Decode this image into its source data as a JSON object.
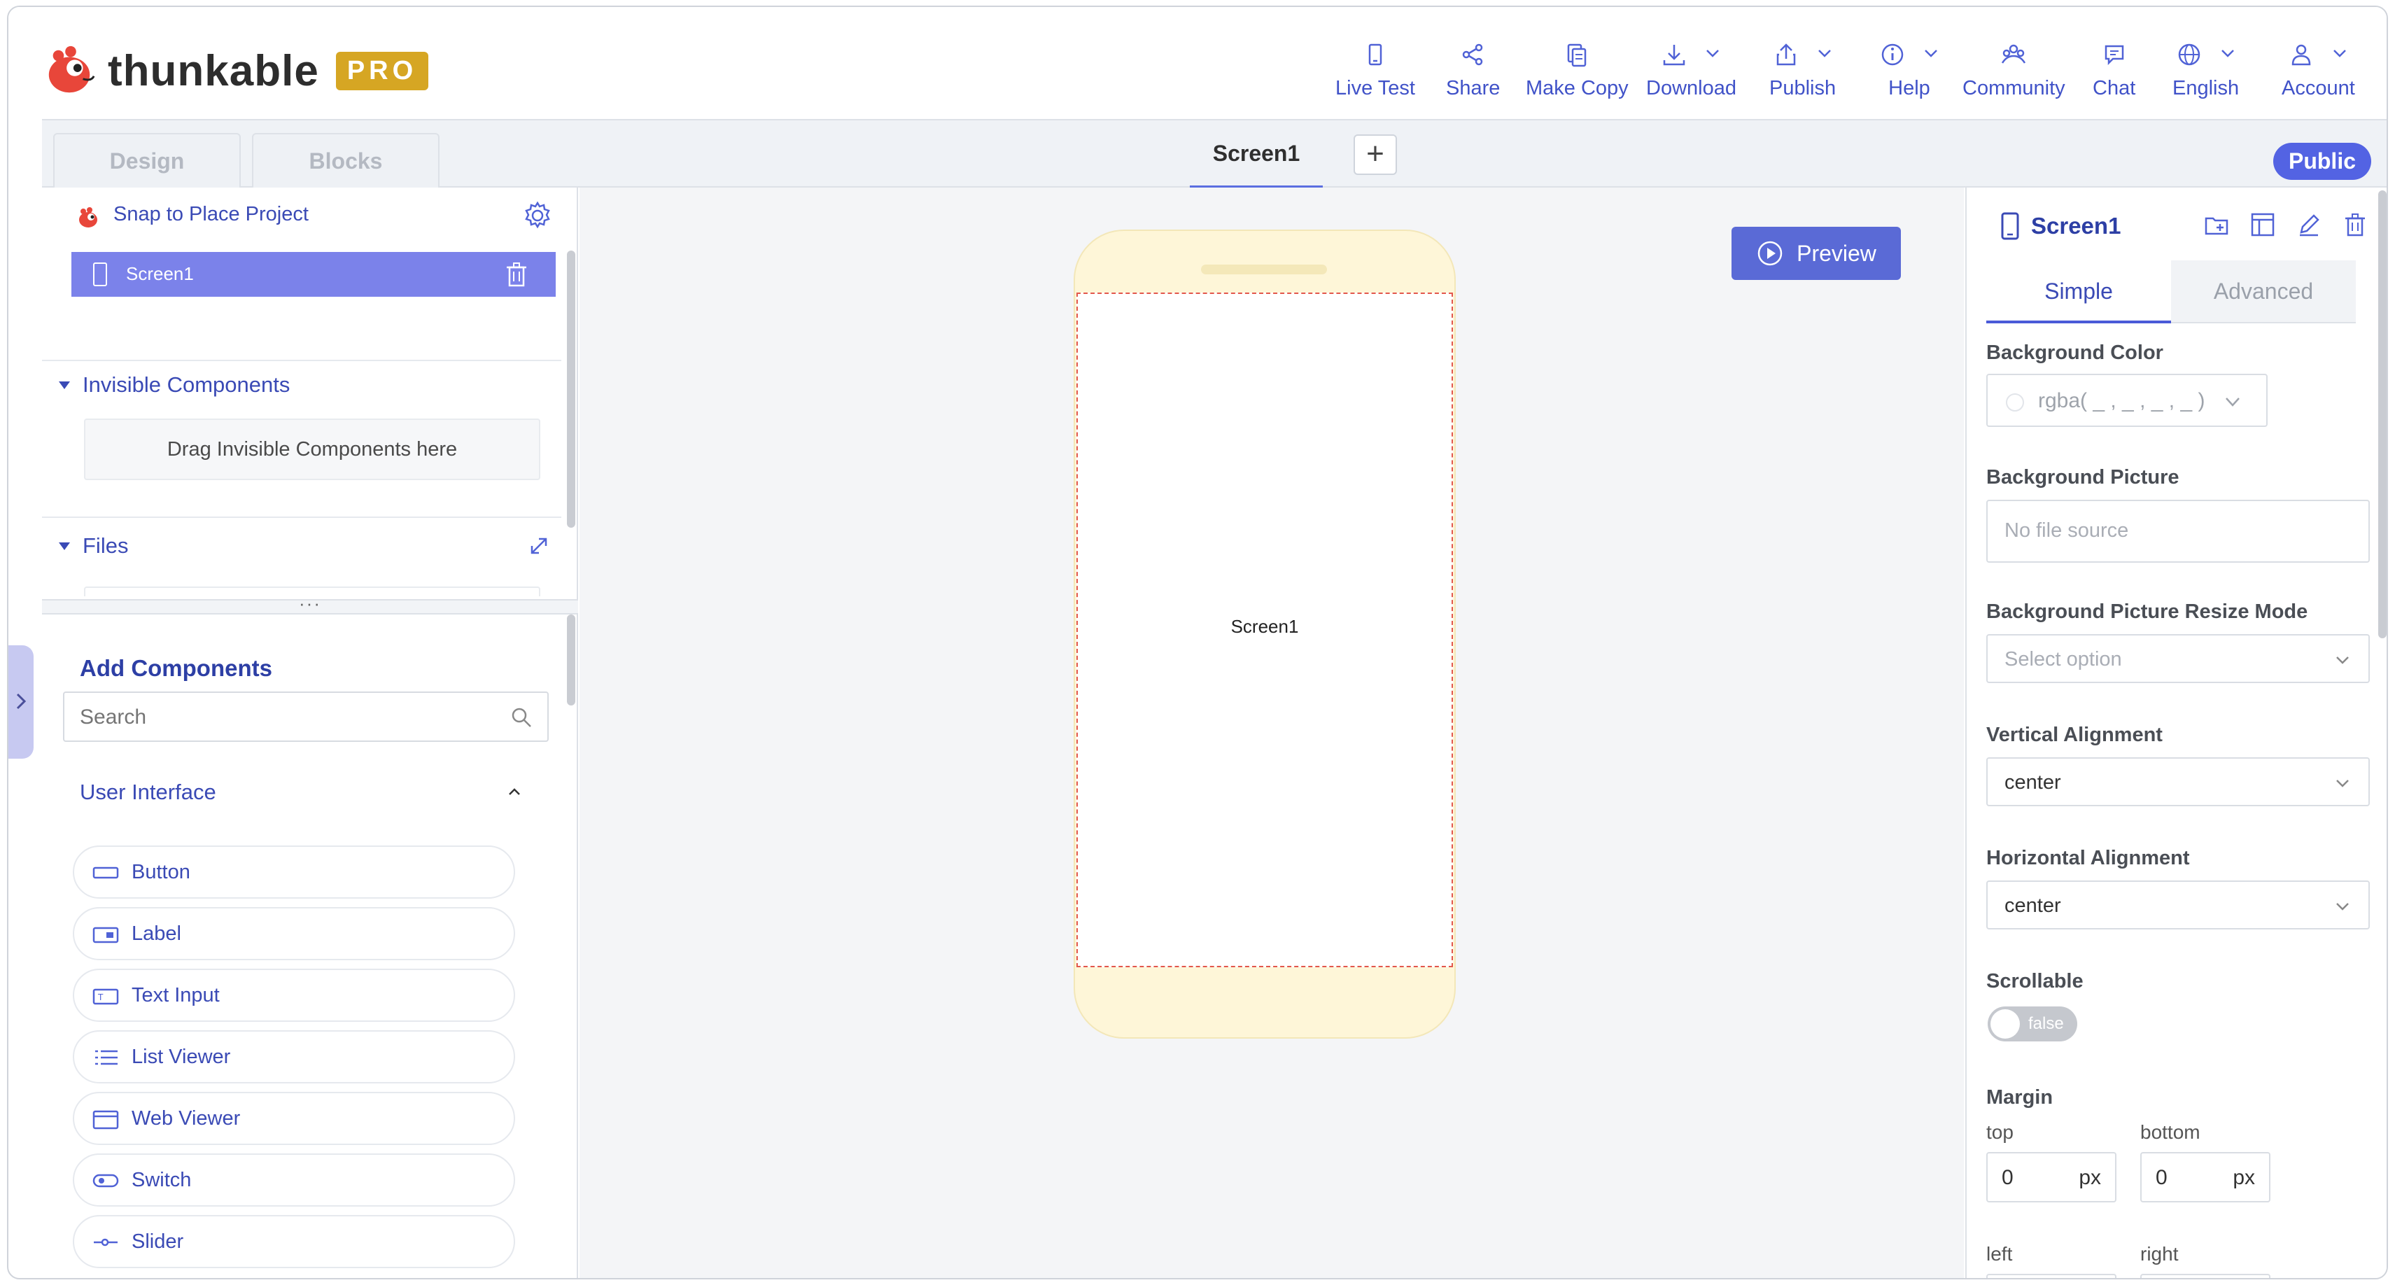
{
  "brand": {
    "name": "thunkable",
    "badge": "PRO"
  },
  "topnav": {
    "live_test": "Live Test",
    "share": "Share",
    "make_copy": "Make Copy",
    "download": "Download",
    "publish": "Publish",
    "help": "Help",
    "community": "Community",
    "chat": "Chat",
    "language": "English",
    "account": "Account"
  },
  "tabs": {
    "design": "Design",
    "blocks": "Blocks",
    "screen": "Screen1",
    "add": "+",
    "visibility": "Public"
  },
  "left": {
    "project_name": "Snap to Place Project",
    "screens": [
      {
        "label": "Screen1"
      }
    ],
    "invisible_title": "Invisible Components",
    "invisible_drop": "Drag Invisible Components here",
    "files_title": "Files",
    "drag_handle": "···",
    "add_components": "Add Components",
    "search_placeholder": "Search",
    "category": "User Interface",
    "components": [
      {
        "label": "Button",
        "icon": "button-icon"
      },
      {
        "label": "Label",
        "icon": "label-icon"
      },
      {
        "label": "Text Input",
        "icon": "text-input-icon"
      },
      {
        "label": "List Viewer",
        "icon": "list-viewer-icon"
      },
      {
        "label": "Web Viewer",
        "icon": "web-viewer-icon"
      },
      {
        "label": "Switch",
        "icon": "switch-icon"
      },
      {
        "label": "Slider",
        "icon": "slider-icon"
      }
    ]
  },
  "canvas": {
    "preview": "Preview",
    "screen_label": "Screen1"
  },
  "right": {
    "title": "Screen1",
    "tab_simple": "Simple",
    "tab_advanced": "Advanced",
    "bg_color_label": "Background Color",
    "bg_color_value": "rgba( _ , _ , _ , _ )",
    "bg_picture_label": "Background Picture",
    "bg_picture_value": "No file source",
    "resize_label": "Background Picture Resize Mode",
    "resize_value": "Select option",
    "valign_label": "Vertical Alignment",
    "valign_value": "center",
    "halign_label": "Horizontal Alignment",
    "halign_value": "center",
    "scrollable_label": "Scrollable",
    "scrollable_value": "false",
    "margin_label": "Margin",
    "margin_top_label": "top",
    "margin_bottom_label": "bottom",
    "margin_left_label": "left",
    "margin_right_label": "right",
    "margin_top": "0",
    "margin_bottom": "0",
    "unit": "px"
  },
  "colors": {
    "accent": "#5363e3",
    "selected_screen": "#7b82ea",
    "pro_badge": "#d6a623",
    "canvas_bg": "#f4f5f7",
    "phone_frame": "#fef6d8"
  }
}
